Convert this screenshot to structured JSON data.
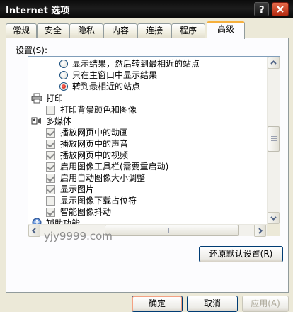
{
  "window": {
    "title": "Internet 选项"
  },
  "tabs": [
    "常规",
    "安全",
    "隐私",
    "内容",
    "连接",
    "程序",
    "高级"
  ],
  "active_tab": "高级",
  "settings_label": "设置(S):",
  "tree": {
    "radios": [
      {
        "label": "显示结果，然后转到最相近的站点",
        "checked": false
      },
      {
        "label": "只在主窗口中显示结果",
        "checked": false
      },
      {
        "label": "转到最相近的站点",
        "checked": true
      }
    ],
    "categories": [
      {
        "label": "打印",
        "icon": "printer-icon",
        "items": [
          {
            "label": "打印背景颜色和图像",
            "checked": false
          }
        ]
      },
      {
        "label": "多媒体",
        "icon": "multimedia-icon",
        "items": [
          {
            "label": "播放网页中的动画",
            "checked": true
          },
          {
            "label": "播放网页中的声音",
            "checked": true
          },
          {
            "label": "播放网页中的视频",
            "checked": true
          },
          {
            "label": "启用图像工具栏(需要重启动)",
            "checked": true
          },
          {
            "label": "启用自动图像大小调整",
            "checked": true
          },
          {
            "label": "显示图片",
            "checked": true
          },
          {
            "label": "显示图像下载占位符",
            "checked": false
          },
          {
            "label": "智能图像抖动",
            "checked": true
          }
        ]
      },
      {
        "label": "辅助功能",
        "icon": "accessibility-icon",
        "items": []
      }
    ]
  },
  "watermark": "yjy9999.com",
  "buttons": {
    "restore_defaults": "还原默认设置(R)",
    "ok": "确定",
    "cancel": "取消",
    "apply": "应用(A)"
  },
  "colors": {
    "titlebar": "#111111",
    "active_tab_accent": "#f6b03d",
    "radio_dot": "#c0140a"
  }
}
